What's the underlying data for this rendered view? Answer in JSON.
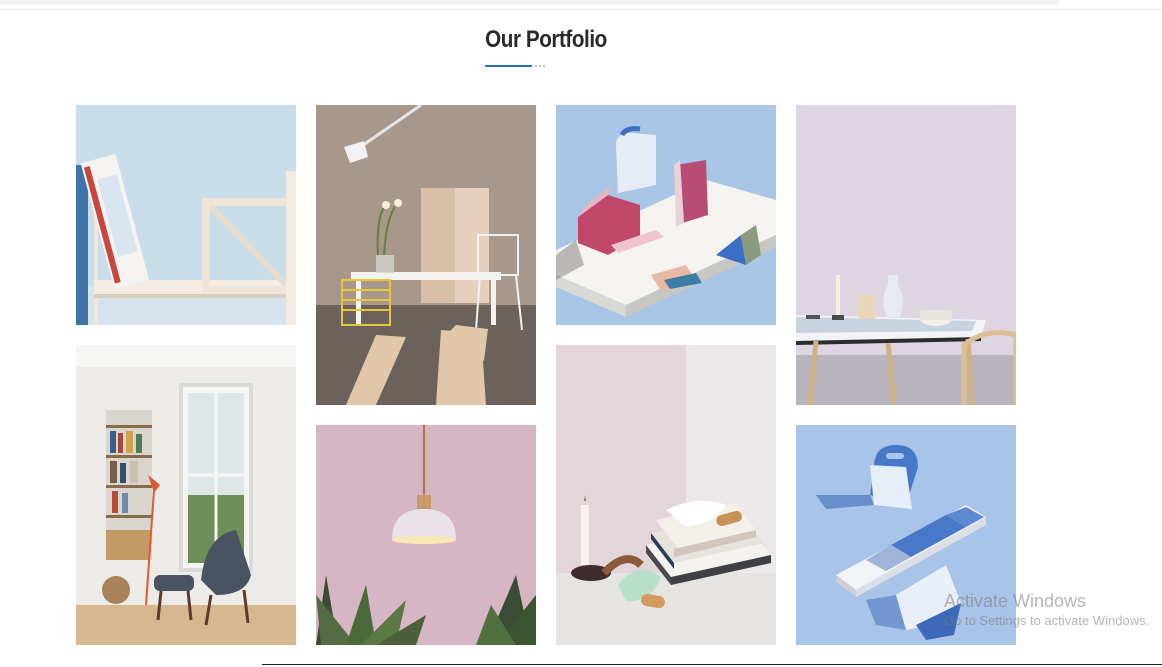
{
  "portfolio": {
    "title": "Our Portfolio",
    "accent_color": "#2f6db5",
    "items": [
      {
        "name": "book-shelf"
      },
      {
        "name": "living-room-chairs"
      },
      {
        "name": "lamp-wood-planks"
      },
      {
        "name": "pendant-lamp"
      },
      {
        "name": "paper-houses"
      },
      {
        "name": "candle-books"
      },
      {
        "name": "dining-table"
      },
      {
        "name": "paper-folds"
      }
    ]
  },
  "watermark": {
    "title": "Activate Windows",
    "subtitle": "Go to Settings to activate Windows."
  }
}
